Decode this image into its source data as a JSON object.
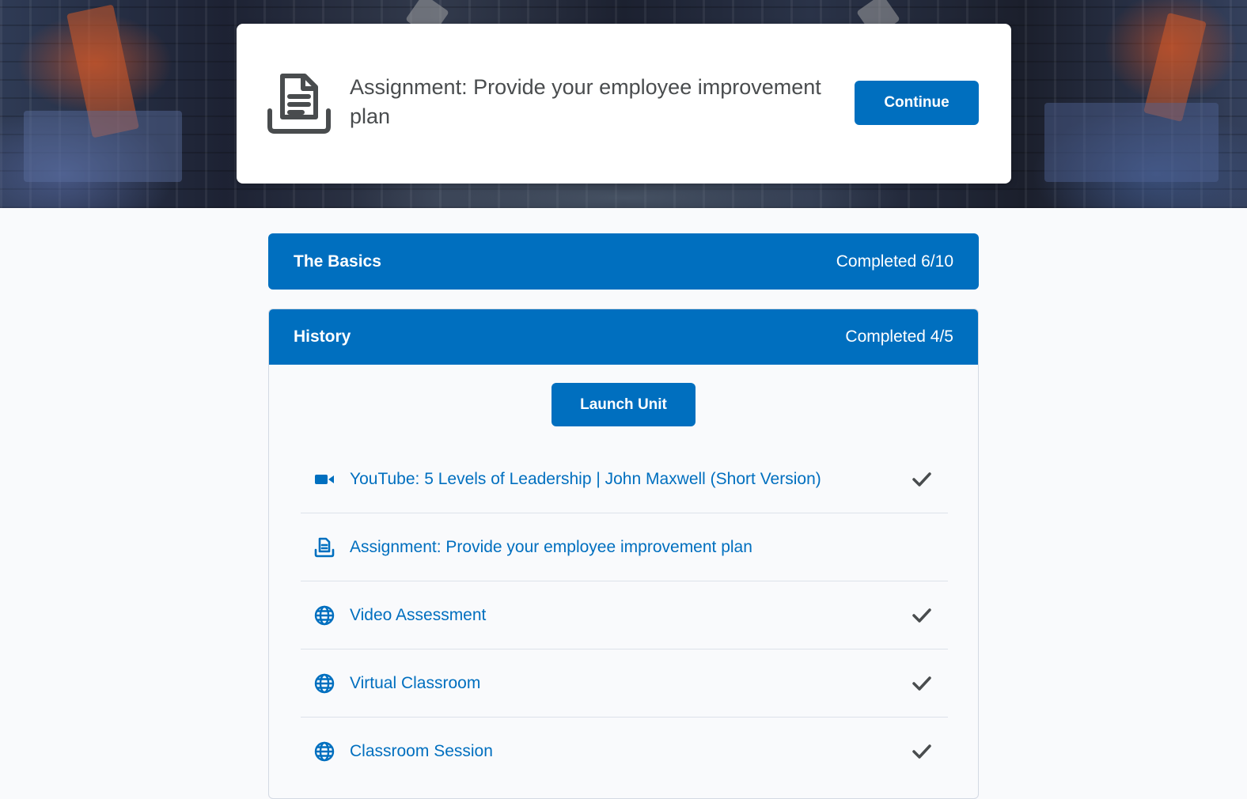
{
  "hero": {
    "card_title": "Assignment: Provide your employee improvement plan",
    "card_icon": "assignment-document-icon",
    "continue_label": "Continue"
  },
  "units": [
    {
      "name": "The Basics",
      "status": "Completed 6/10"
    },
    {
      "name": "History",
      "status": "Completed 4/5"
    }
  ],
  "history": {
    "launch_label": "Launch Unit",
    "activities": [
      {
        "type_icon": "video-camera-icon",
        "label": "YouTube: 5 Levels of Leadership | John Maxwell (Short Version)",
        "completed": true
      },
      {
        "type_icon": "assignment-icon",
        "label": "Assignment: Provide your employee improvement plan",
        "completed": false
      },
      {
        "type_icon": "globe-icon",
        "label": "Video Assessment",
        "completed": true
      },
      {
        "type_icon": "globe-icon",
        "label": "Virtual Classroom",
        "completed": true
      },
      {
        "type_icon": "globe-icon",
        "label": "Classroom Session",
        "completed": true
      }
    ]
  },
  "colors": {
    "accent": "#006fbf",
    "text": "#494c4e",
    "check": "#494c4e",
    "page_bg": "#f9fafc"
  }
}
